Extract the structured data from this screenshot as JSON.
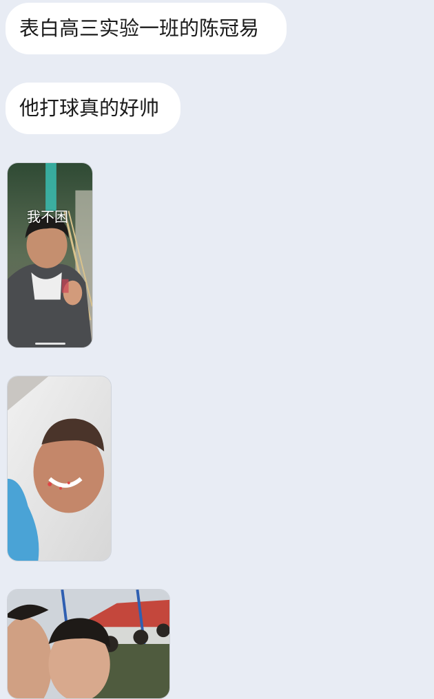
{
  "chat": {
    "messages": [
      {
        "type": "text",
        "text": "表白高三实验一班的陈冠易"
      },
      {
        "type": "text",
        "text": "他打球真的好帅"
      },
      {
        "type": "image",
        "subject": "photo-selfie-boy-hoodie",
        "overlay_text": "我不困"
      },
      {
        "type": "image",
        "subject": "photo-selfie-boy-smiling"
      },
      {
        "type": "image",
        "subject": "photo-group-boys-outdoor"
      }
    ]
  },
  "colors": {
    "background": "#e8ecf4",
    "bubble": "#ffffff",
    "text": "#1a1a1a"
  }
}
